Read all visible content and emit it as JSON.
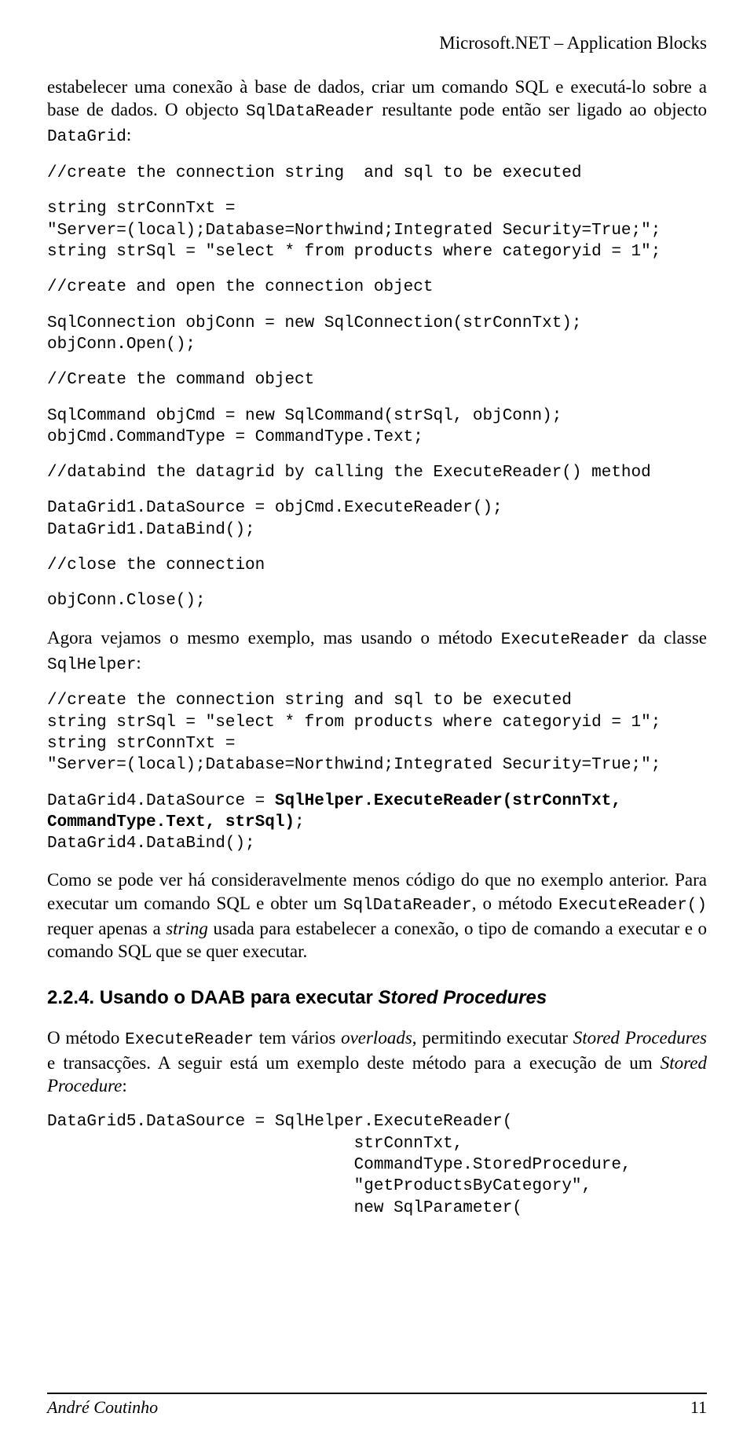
{
  "header": {
    "right": "Microsoft.NET – Application Blocks"
  },
  "para1_a": "estabelecer uma conexão à base de dados, criar um comando SQL e executá-lo sobre a base de dados. O objecto ",
  "para1_code1": "SqlDataReader",
  "para1_b": " resultante pode então ser ligado ao objecto ",
  "para1_code2": "DataGrid",
  "para1_c": ":",
  "code_block_1a": "//create the connection string  and sql to be executed",
  "code_block_1b": "string strConnTxt =\n\"Server=(local);Database=Northwind;Integrated Security=True;\";\nstring strSql = \"select * from products where categoryid = 1\";",
  "code_block_1c": "//create and open the connection object",
  "code_block_1d": "SqlConnection objConn = new SqlConnection(strConnTxt);\nobjConn.Open();",
  "code_block_1e": "//Create the command object",
  "code_block_1f": "SqlCommand objCmd = new SqlCommand(strSql, objConn);\nobjCmd.CommandType = CommandType.Text;",
  "code_block_1g": "//databind the datagrid by calling the ExecuteReader() method",
  "code_block_1h": "DataGrid1.DataSource = objCmd.ExecuteReader();\nDataGrid1.DataBind();",
  "code_block_1i": "//close the connection",
  "code_block_1j": "objConn.Close();",
  "para2_a": "Agora vejamos o mesmo exemplo, mas usando o método ",
  "para2_code1": "ExecuteReader",
  "para2_b": " da classe ",
  "para2_code2": "SqlHelper",
  "para2_c": ":",
  "code_block_2a": "//create the connection string and sql to be executed\nstring strSql = \"select * from products where categoryid = 1\";\nstring strConnTxt =\n\"Server=(local);Database=Northwind;Integrated Security=True;\";",
  "code_block_2b_pre": "DataGrid4.DataSource = ",
  "code_block_2b_bold": "SqlHelper.ExecuteReader(strConnTxt, CommandType.Text, strSql)",
  "code_block_2b_post": ";\nDataGrid4.DataBind();",
  "para3_a": "Como se pode ver há consideravelmente menos código do que no exemplo anterior. Para executar um comando SQL e obter um ",
  "para3_code1": "SqlDataReader",
  "para3_b": ", o método ",
  "para3_code2": "ExecuteReader()",
  "para3_c": " requer apenas a ",
  "para3_em": "string",
  "para3_d": " usada para estabelecer a conexão, o tipo de comando a executar e o comando SQL que se quer executar.",
  "heading": "2.2.4. Usando o DAAB para executar ",
  "heading_em": "Stored Procedures",
  "para4_a": "O método ",
  "para4_code1": "ExecuteReader",
  "para4_b": " tem vários ",
  "para4_em1": "overloads",
  "para4_c": ", permitindo executar ",
  "para4_em2": "Stored Procedures",
  "para4_d": " e transacções. A seguir está um exemplo deste método para a execução de um ",
  "para4_em3": "Stored Procedure",
  "para4_e": ":",
  "code_block_3": "DataGrid5.DataSource = SqlHelper.ExecuteReader(\n                               strConnTxt,\n                               CommandType.StoredProcedure,\n                               \"getProductsByCategory\",\n                               new SqlParameter(",
  "footer": {
    "left": "André Coutinho",
    "right": "11"
  }
}
